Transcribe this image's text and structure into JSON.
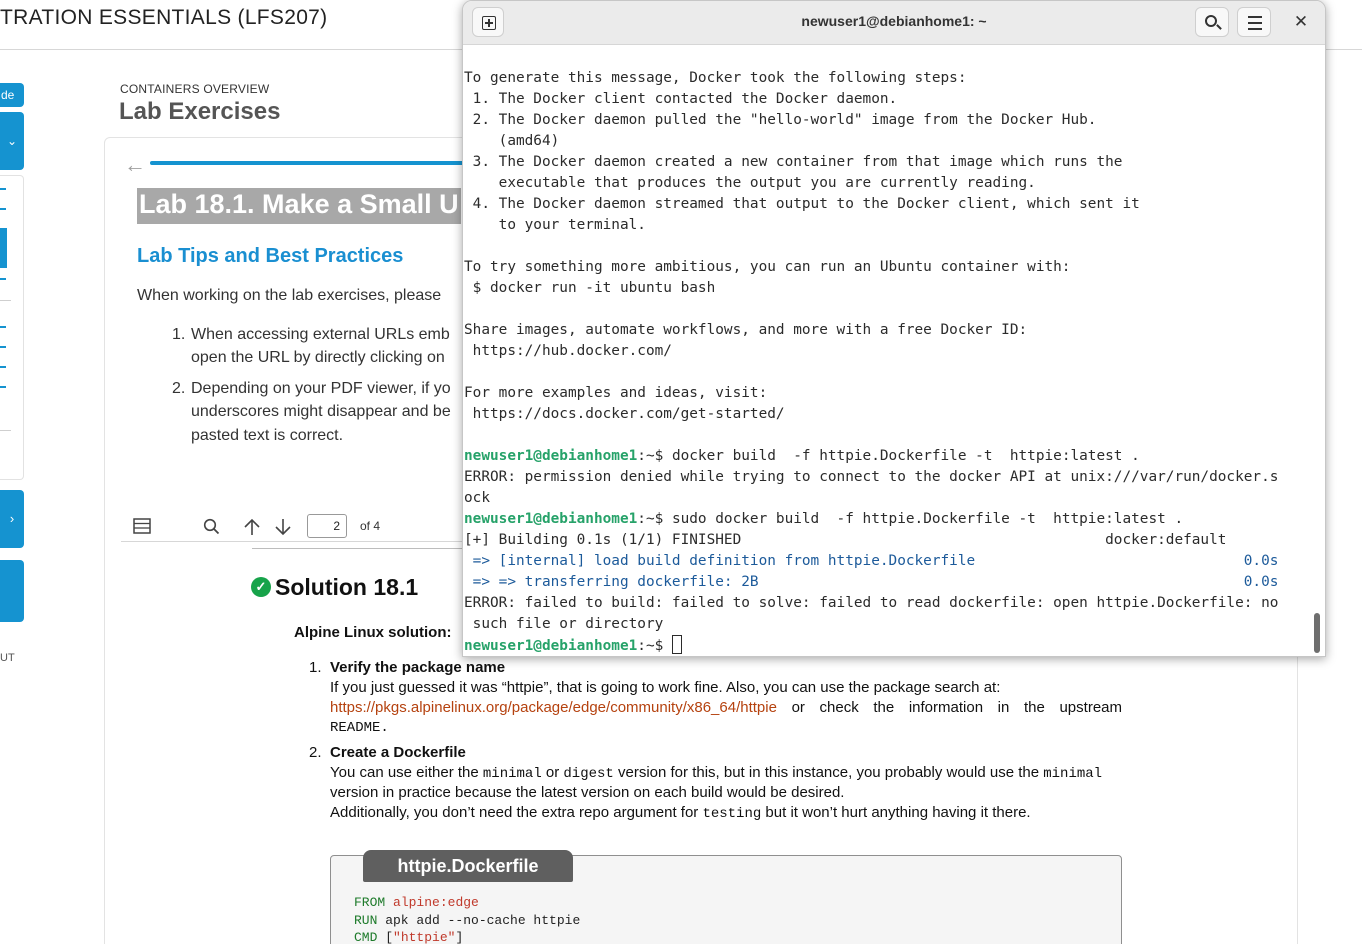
{
  "course": {
    "title": "TRATION ESSENTIALS (LFS207)",
    "section_kicker": "CONTAINERS OVERVIEW",
    "section_title": "Lab Exercises",
    "rail_top_label": "de",
    "rail_out_label": "UT"
  },
  "lab": {
    "heading": "Lab 18.1. Make a Small U",
    "tips_heading": "Lab Tips and Best Practices",
    "tips_intro": "When working on the lab exercises, please",
    "tips": [
      {
        "num": "1.",
        "lines": [
          "When accessing external URLs emb",
          "open the URL by directly clicking on"
        ]
      },
      {
        "num": "2.",
        "lines": [
          "Depending on your PDF viewer, if yo",
          "underscores might disappear and be",
          "pasted text is correct."
        ]
      }
    ]
  },
  "pdf_toolbar": {
    "page_value": "2",
    "page_total": "of 4"
  },
  "pdf": {
    "solution_title": "Solution 18.1",
    "alpine_label": "Alpine Linux solution:",
    "steps": [
      {
        "num": "1.",
        "title": "Verify the package name",
        "line1": "If you just guessed it was “httpie”, that is going to work fine. Also, you can use the package search at:",
        "link": "https://pkgs.alpinelinux.org/package/edge/community/x86_64/httpie",
        "line2_rest_a": "or",
        "line2_rest_b": "check",
        "line2_rest_c": "the",
        "line2_rest_d": "information",
        "line2_rest_e": "in",
        "line2_rest_f": "the",
        "line2_rest_g": "upstream",
        "line3": "README."
      },
      {
        "num": "2.",
        "title": "Create a Dockerfile",
        "line1_a": "You can use either the ",
        "line1_b": "minimal",
        "line1_c": " or ",
        "line1_d": "digest",
        "line1_e": " version for this, but in this instance, you probably would use the ",
        "line1_f": "minimal",
        "line2": "version in practice because the latest version on each build would be desired.",
        "line3_a": "Additionally, you don’t need the extra repo argument for ",
        "line3_b": "testing",
        "line3_c": " but it won’t hurt anything having it there."
      }
    ],
    "code_tab": "httpie.Dockerfile",
    "code": [
      {
        "kw": "FROM",
        "rest": " ",
        "str": "alpine:edge",
        "tail": ""
      },
      {
        "kw": "RUN",
        "rest": " apk add --no-cache httpie",
        "str": "",
        "tail": ""
      },
      {
        "kw": "CMD",
        "rest": " [",
        "str": "\"httpie\"",
        "tail": "]"
      }
    ]
  },
  "terminal": {
    "title": "newuser1@debianhome1: ~",
    "prompt_user": "newuser1@debianhome1",
    "prompt_suffix": ":~$ ",
    "lines": {
      "l01": "To generate this message, Docker took the following steps:",
      "l02": " 1. The Docker client contacted the Docker daemon.",
      "l03": " 2. The Docker daemon pulled the \"hello-world\" image from the Docker Hub.",
      "l04": "    (amd64)",
      "l05": " 3. The Docker daemon created a new container from that image which runs the",
      "l06": "    executable that produces the output you are currently reading.",
      "l07": " 4. The Docker daemon streamed that output to the Docker client, which sent it",
      "l08": "    to your terminal.",
      "l09": "",
      "l10": "To try something more ambitious, you can run an Ubuntu container with:",
      "l11": " $ docker run -it ubuntu bash",
      "l12": "",
      "l13": "Share images, automate workflows, and more with a free Docker ID:",
      "l14": " https://hub.docker.com/",
      "l15": "",
      "l16": "For more examples and ideas, visit:",
      "l17": " https://docs.docker.com/get-started/",
      "l18": "",
      "cmd1": "docker build  -f httpie.Dockerfile -t  httpie:latest .",
      "l20": "ERROR: permission denied while trying to connect to the docker API at unix:///var/run/docker.s",
      "l21": "ock",
      "cmd2": "sudo docker build  -f httpie.Dockerfile -t  httpie:latest .",
      "l23": "[+] Building 0.1s (1/1) FINISHED                                          docker:default",
      "l24": " => [internal] load build definition from httpie.Dockerfile                               0.0s",
      "l25": " => => transferring dockerfile: 2B                                                        0.0s",
      "l26": "ERROR: failed to build: failed to solve: failed to read dockerfile: open httpie.Dockerfile: no",
      "l27": " such file or directory"
    }
  },
  "colors": {
    "accent": "#1593d0",
    "prompt_green": "#26a269",
    "build_blue": "#1c5a9a",
    "link_orange": "#b5420f",
    "check_green": "#17a34a"
  },
  "icons": {
    "new_tab": "new-tab-icon",
    "search": "search-icon",
    "menu": "hamburger-menu-icon",
    "close": "close-icon",
    "back": "arrow-left-icon",
    "check": "check-circle-icon"
  }
}
